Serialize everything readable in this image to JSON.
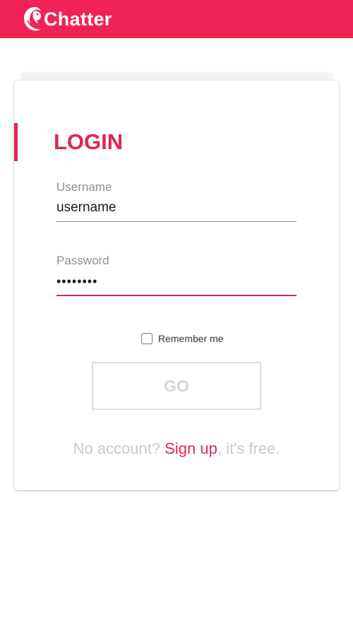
{
  "header": {
    "app_name": "Chatter",
    "logo_icon": "dolphin-logo-icon",
    "brand_color": "#ef2355"
  },
  "login": {
    "title": "LOGIN",
    "username": {
      "label": "Username",
      "value": "username"
    },
    "password": {
      "label": "Password",
      "value": "••••••••"
    },
    "remember_me": {
      "label": "Remember me",
      "checked": false
    },
    "submit_label": "GO",
    "signup": {
      "prefix": "No account? ",
      "link_label": "Sign up",
      "suffix": ", it's free."
    },
    "accent_color": "#e0264f"
  }
}
